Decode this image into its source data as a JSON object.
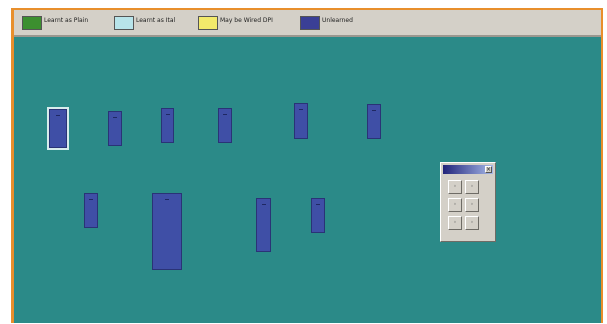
{
  "legend": {
    "items": [
      {
        "label": "Learnt as Plain",
        "color": "#3c8f2f"
      },
      {
        "label": "Learnt as Ital",
        "color": "#b8e4ea"
      },
      {
        "label": "May be Wired DPI",
        "color": "#f3ea6b"
      },
      {
        "label": "Unlearned",
        "color": "#3a3f96"
      }
    ]
  },
  "canvas": {
    "background": "#2b8a88",
    "device_color": "#3f4fa6",
    "devices": [
      {
        "id": "1",
        "selected": true
      },
      {
        "id": "2",
        "selected": false
      },
      {
        "id": "3",
        "selected": false
      },
      {
        "id": "4",
        "selected": false
      },
      {
        "id": "5",
        "selected": false
      },
      {
        "id": "6",
        "selected": false
      },
      {
        "id": "7",
        "selected": false
      },
      {
        "id": "8",
        "selected": false
      },
      {
        "id": "9",
        "selected": false
      },
      {
        "id": "10",
        "selected": false
      }
    ]
  },
  "palette": {
    "close_glyph": "×",
    "buttons": [
      "icon-a",
      "icon-b",
      "icon-c",
      "icon-d",
      "icon-e",
      "icon-f"
    ]
  }
}
